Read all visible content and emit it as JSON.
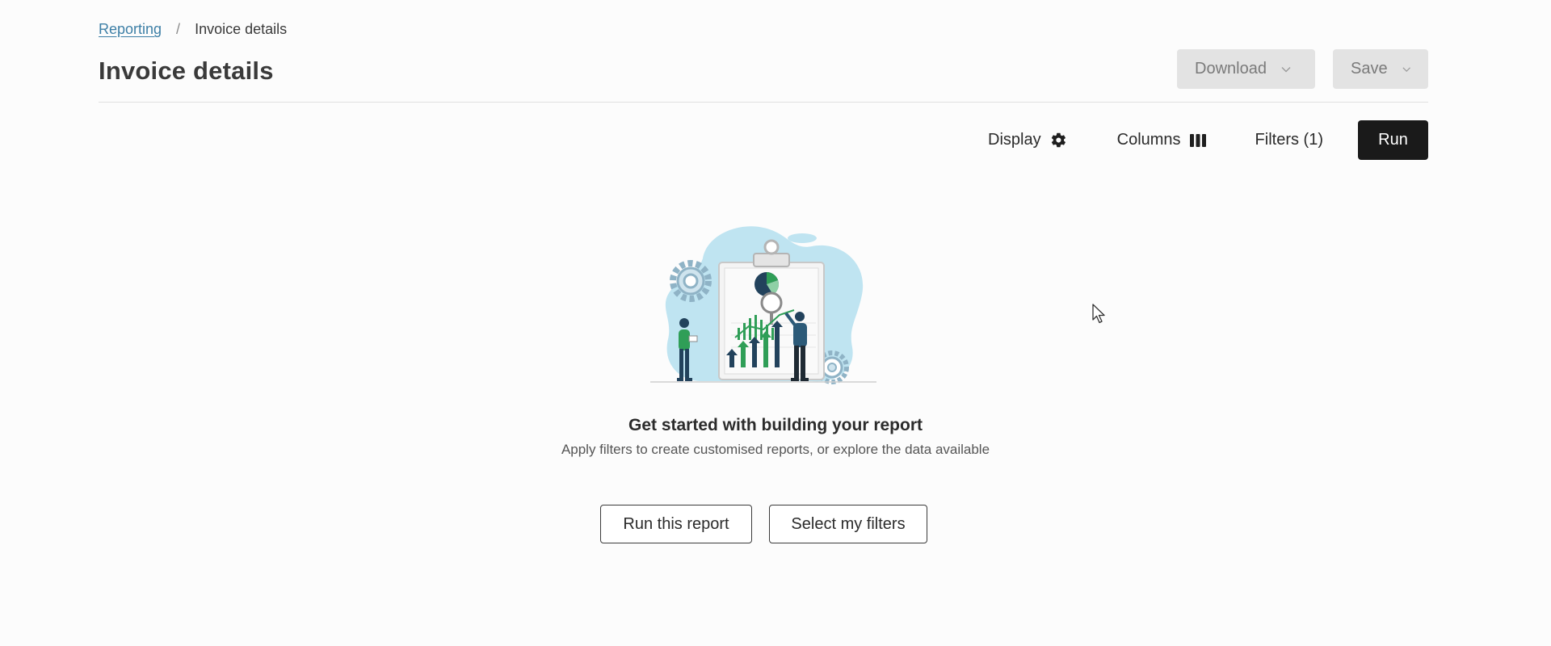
{
  "breadcrumb": {
    "parent": "Reporting",
    "separator": "/",
    "current": "Invoice details"
  },
  "page_title": "Invoice details",
  "header_actions": {
    "download_label": "Download",
    "save_label": "Save"
  },
  "toolbar": {
    "display_label": "Display",
    "columns_label": "Columns",
    "filters_label": "Filters (1)",
    "run_label": "Run"
  },
  "empty_state": {
    "title": "Get started with building your report",
    "subtitle": "Apply filters to create customised reports, or explore the data available",
    "run_report_label": "Run this report",
    "select_filters_label": "Select my filters"
  },
  "icons": {
    "display": "gear-icon",
    "columns": "columns-icon",
    "dropdown": "chevron-down-icon"
  },
  "colors": {
    "link": "#3d7fa6",
    "primary_button": "#1a1a1a",
    "disabled_button": "#e3e3e3",
    "illustration_blob": "#bfe4f1",
    "illustration_green": "#2f9e57",
    "illustration_navy": "#22425c"
  }
}
